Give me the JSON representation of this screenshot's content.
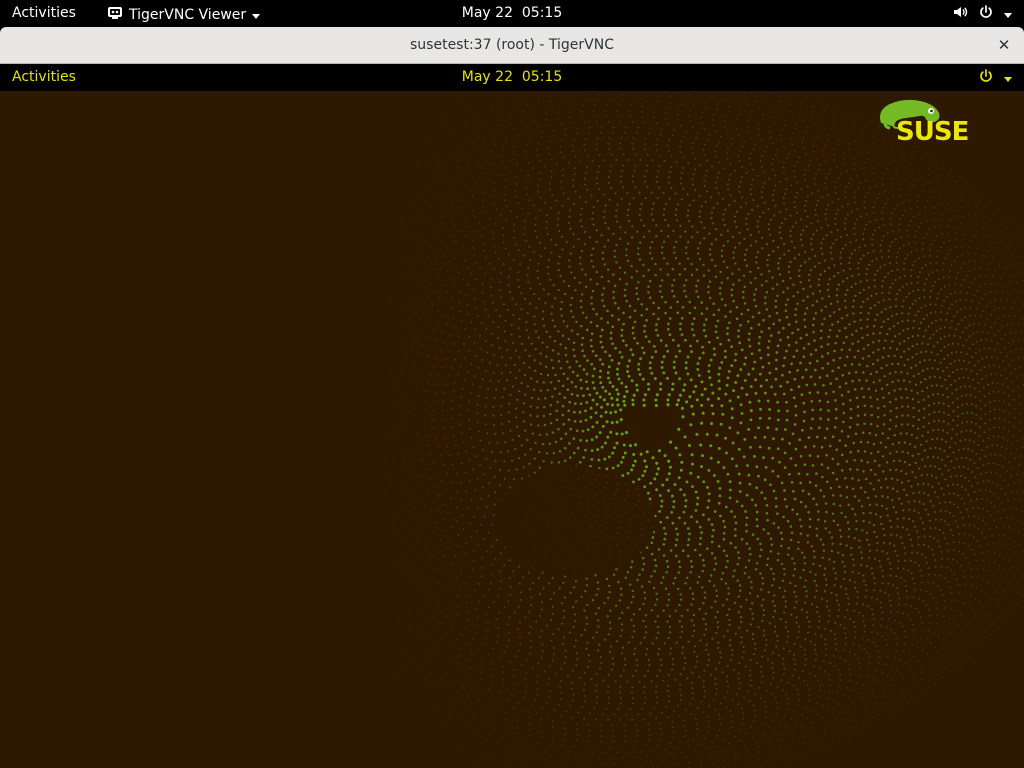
{
  "host_topbar": {
    "activities": "Activities",
    "app_menu_label": "TigerVNC Viewer",
    "app_icon": "tigervnc-icon",
    "clock": "May 22  05:15",
    "status_icons": [
      "volume-icon",
      "power-icon",
      "chevron-down-icon"
    ]
  },
  "window": {
    "title": "susetest:37 (root) - TigerVNC",
    "close_icon": "close-icon",
    "close_glyph": "✕"
  },
  "remote_topbar": {
    "activities": "Activities",
    "clock": "May 22  05:15",
    "status_icons": [
      "power-icon",
      "chevron-down-icon"
    ],
    "accent_color": "#e8e200"
  },
  "desktop": {
    "background_color": "#2f1800",
    "pattern_color": "#6cc417",
    "logo_text": "SUSE"
  }
}
